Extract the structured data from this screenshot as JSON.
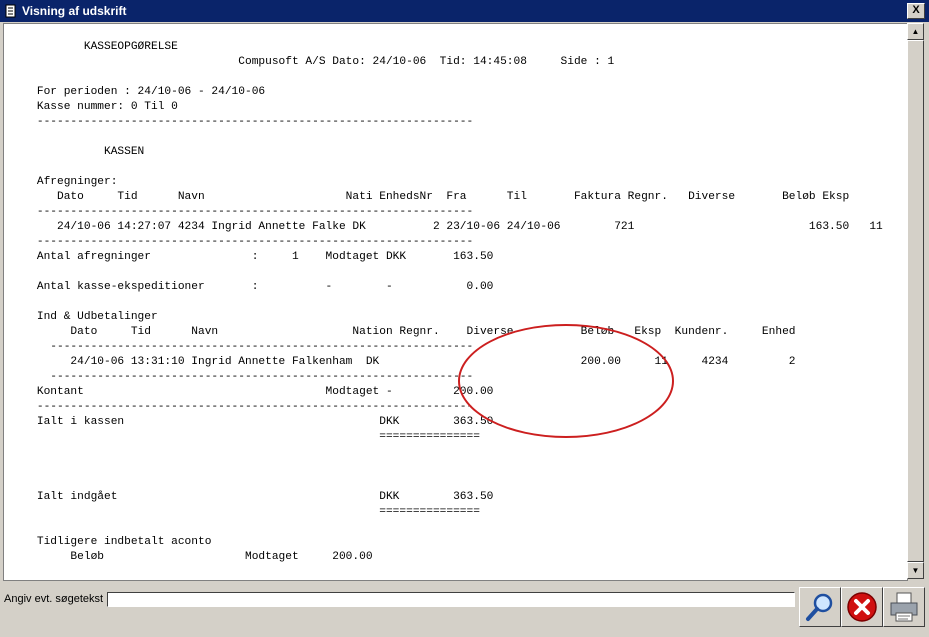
{
  "window": {
    "title": "Visning af udskrift",
    "close_glyph": "X"
  },
  "report": {
    "text": "           KASSEOPGØRELSE\n                                  Compusoft A/S Dato: 24/10-06  Tid: 14:45:08     Side : 1\n\n    For perioden : 24/10-06 - 24/10-06\n    Kasse nummer: 0 Til 0\n    -----------------------------------------------------------------\n\n              KASSEN\n\n    Afregninger:\n       Dato     Tid      Navn                     Nati EnhedsNr  Fra      Til       Faktura Regnr.   Diverse       Beløb Eksp\n    -----------------------------------------------------------------\n       24/10-06 14:27:07 4234 Ingrid Annette Falke DK          2 23/10-06 24/10-06        721                          163.50   11\n    -----------------------------------------------------------------\n    Antal afregninger               :     1    Modtaget DKK       163.50\n\n    Antal kasse-ekspeditioner       :          -        -           0.00\n\n    Ind & Udbetalinger\n         Dato     Tid      Navn                    Nation Regnr.    Diverse          Beløb   Eksp  Kundenr.     Enhed\n      ---------------------------------------------------------------\n         24/10-06 13:31:10 Ingrid Annette Falkenham  DK                              200.00     11     4234         2\n      ---------------------------------------------------------------\n    Kontant                                    Modtaget -         200.00\n    -----------------------------------------------------------------\n    Ialt i kassen                                      DKK        363.50\n                                                       ===============\n\n\n\n    Ialt indgået                                       DKK        363.50\n                                                       ===============\n\n    Tidligere indbetalt aconto\n         Beløb                     Modtaget     200.00"
  },
  "scrollbar": {
    "up_glyph": "▲",
    "down_glyph": "▼"
  },
  "search": {
    "label": "Angiv evt. søgetekst",
    "value": ""
  },
  "toolbar": {
    "search_icon": "magnifier-icon",
    "cancel_icon": "cancel-icon",
    "print_icon": "printer-icon"
  }
}
